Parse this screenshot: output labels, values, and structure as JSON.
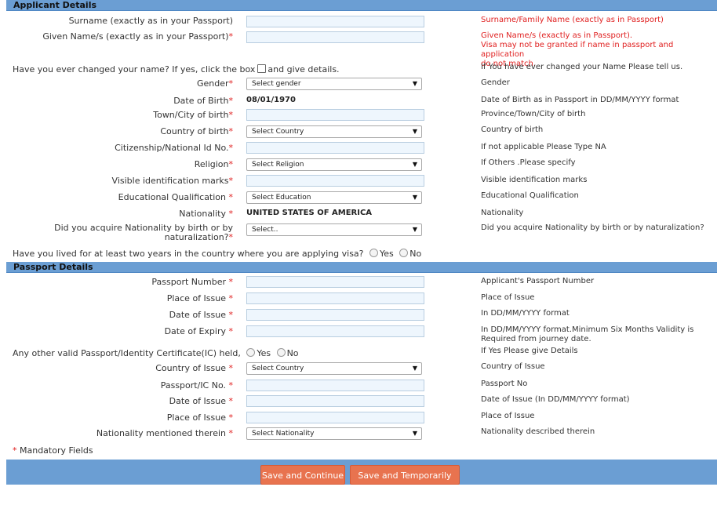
{
  "sections": {
    "applicant": "Applicant Details",
    "passport": "Passport Details"
  },
  "icons": {
    "select_arrow": "▼",
    "required_mark": "*"
  },
  "applicant": {
    "surname": {
      "label": "Surname (exactly as in your Passport)",
      "help": "Surname/Family Name (exactly as in Passport)"
    },
    "given_name": {
      "label": "Given Name/s (exactly as in your Passport)",
      "help1": "Given Name/s (exactly as in Passport).",
      "help2": "Visa may not be granted if name in passport and application",
      "help3": "do not match."
    },
    "changed_name": {
      "label_pre": "Have you ever changed your name? If yes, click the box",
      "label_post": "and give details.",
      "help": "If You have ever changed your Name Please tell us."
    },
    "gender": {
      "label": "Gender",
      "value": "Select gender",
      "help": "Gender"
    },
    "dob": {
      "label": "Date of Birth",
      "value": "08/01/1970",
      "help": "Date of Birth as in Passport in DD/MM/YYYY format"
    },
    "town": {
      "label": "Town/City of birth",
      "help": "Province/Town/City of birth"
    },
    "country_birth": {
      "label": "Country of birth",
      "value": "Select Country",
      "help": "Country of birth"
    },
    "citizenship": {
      "label": "Citizenship/National Id No.",
      "help": "If not applicable Please Type NA"
    },
    "religion": {
      "label": "Religion",
      "value": "Select Religion",
      "help": "If Others .Please specify"
    },
    "marks": {
      "label": "Visible identification marks",
      "help": "Visible identification marks"
    },
    "education": {
      "label": "Educational Qualification",
      "value": "Select Education",
      "help": "Educational Qualification"
    },
    "nationality": {
      "label": "Nationality",
      "value": "UNITED STATES OF AMERICA",
      "help": "Nationality"
    },
    "acquire": {
      "label1": "Did you acquire Nationality by birth or by",
      "label2": "naturalization?",
      "value": "Select..",
      "help": "Did you acquire Nationality by birth or by naturalization?"
    },
    "two_years": {
      "label": "Have you lived for at least two years in the country where you are applying visa?",
      "yes": "Yes",
      "no": "No"
    }
  },
  "passport": {
    "number": {
      "label": "Passport Number",
      "help": "Applicant's Passport Number"
    },
    "place": {
      "label": "Place of Issue",
      "help": "Place of Issue"
    },
    "date_issue": {
      "label": "Date of Issue",
      "help": "In DD/MM/YYYY format"
    },
    "date_expiry": {
      "label": "Date of Expiry",
      "help1": "In DD/MM/YYYY format.Minimum Six Months Validity is",
      "help2": "Required from journey date."
    },
    "other": {
      "label": "Any other valid Passport/Identity Certificate(IC) held,",
      "yes": "Yes",
      "no": "No",
      "help": "If Yes Please give Details"
    },
    "other_country": {
      "label": "Country of Issue",
      "value": "Select Country",
      "help": "Country of Issue"
    },
    "other_number": {
      "label": "Passport/IC No.",
      "help": "Passport No"
    },
    "other_date": {
      "label": "Date of Issue",
      "help": "Date of Issue (In DD/MM/YYYY format)"
    },
    "other_place": {
      "label": "Place of Issue",
      "help": "Place of Issue"
    },
    "other_nationality": {
      "label": "Nationality mentioned therein",
      "value": "Select Nationality",
      "help": "Nationality described therein"
    }
  },
  "mandatory_note": "Mandatory Fields",
  "buttons": {
    "save_continue": "Save and Continue",
    "save_exit": "Save and Temporarily Exit"
  }
}
